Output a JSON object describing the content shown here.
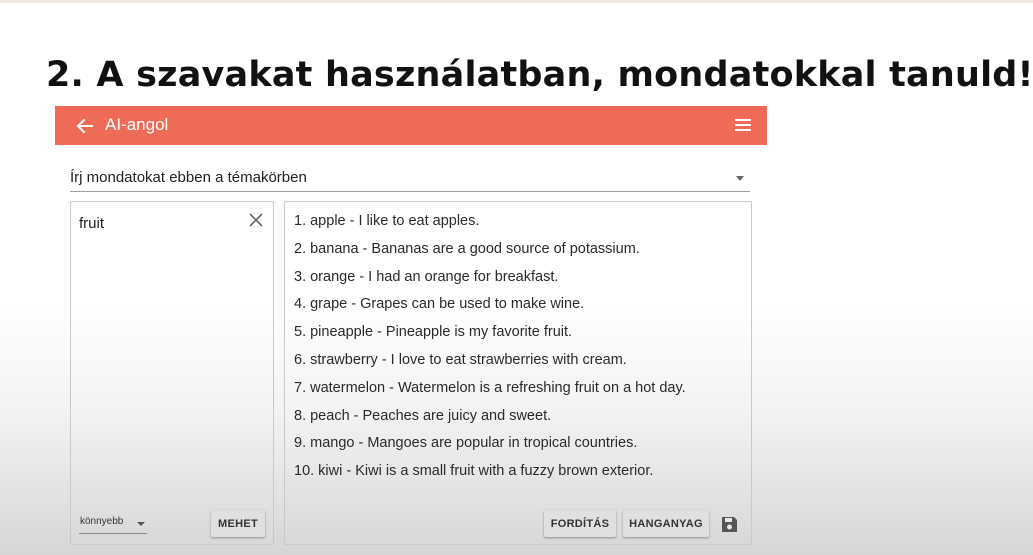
{
  "slide": {
    "title": "2. A szavakat használatban, mondatokkal tanuld!"
  },
  "app": {
    "title": "AI-angol",
    "back_icon": "arrow-left-icon",
    "menu_icon": "hamburger-menu-icon",
    "bar_color": "#ee6b57"
  },
  "topic_select": {
    "label": "Írj mondatokat ebben a témakörben"
  },
  "word_input": {
    "value": "fruit",
    "clear_icon": "close-icon"
  },
  "level_select": {
    "value": "könnyebb"
  },
  "buttons": {
    "go": "MEHET",
    "translate": "FORDÍTÁS",
    "audio": "HANGANYAG",
    "save_icon": "floppy-disk-icon"
  },
  "sentences": [
    "1. apple - I like to eat apples.",
    "2. banana - Bananas are a good source of potassium.",
    "3. orange - I had an orange for breakfast.",
    "4. grape - Grapes can be used to make wine.",
    "5. pineapple - Pineapple is my favorite fruit.",
    "6. strawberry - I love to eat strawberries with cream.",
    "7. watermelon - Watermelon is a refreshing fruit on a hot day.",
    "8. peach - Peaches are juicy and sweet.",
    "9. mango - Mangoes are popular in tropical countries.",
    "10. kiwi - Kiwi is a small fruit with a fuzzy brown exterior."
  ]
}
